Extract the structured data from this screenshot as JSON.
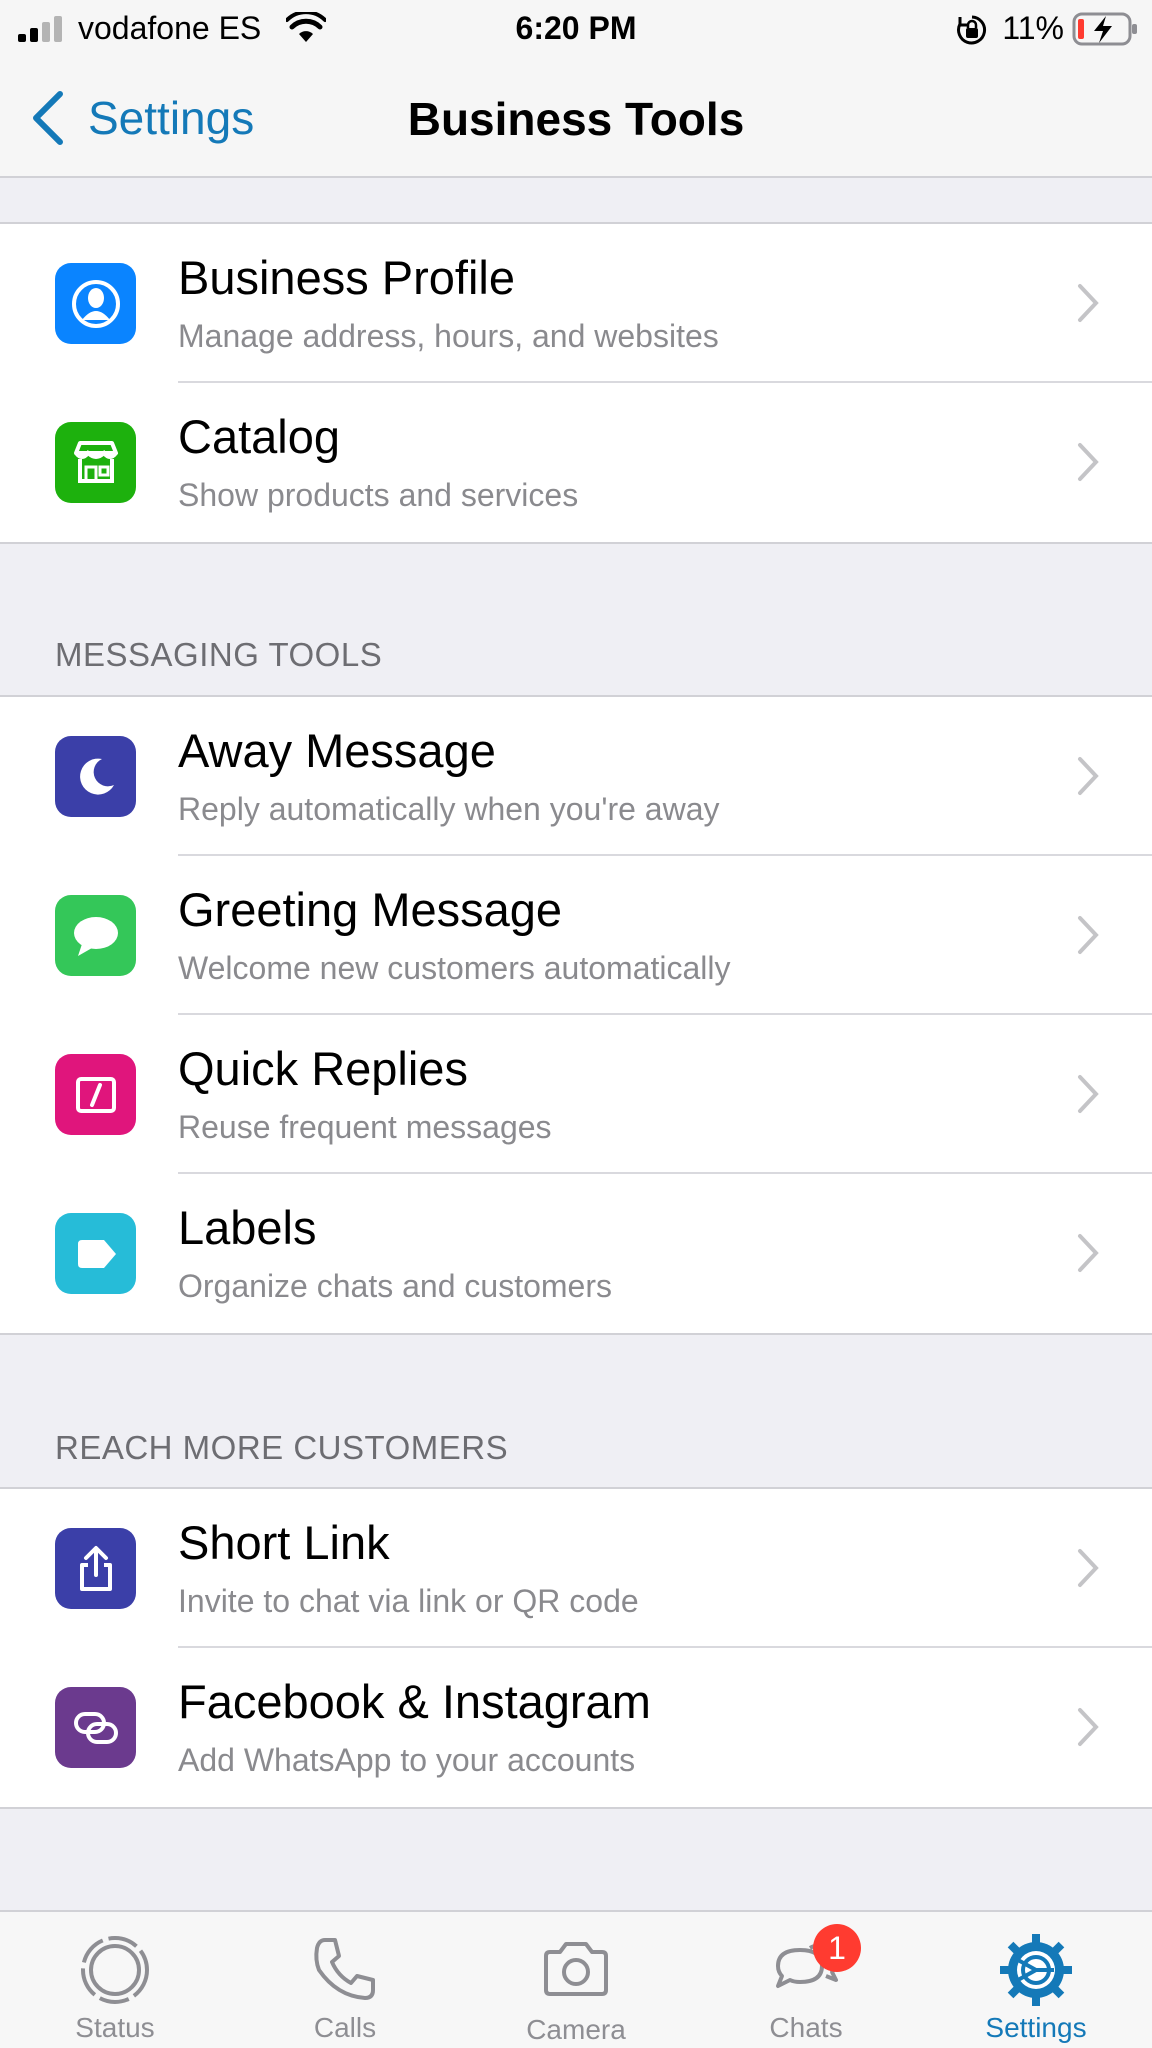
{
  "status_bar": {
    "carrier": "vodafone ES",
    "time": "6:20 PM",
    "battery_percent": "11%"
  },
  "nav": {
    "back_label": "Settings",
    "title": "Business Tools"
  },
  "groups": {
    "profile": [
      {
        "title": "Business Profile",
        "subtitle": "Manage address, hours, and websites",
        "icon": "business-profile-icon",
        "color": "#0a84ff"
      },
      {
        "title": "Catalog",
        "subtitle": "Show products and services",
        "icon": "storefront-icon",
        "color": "#1db10d"
      }
    ],
    "messaging": {
      "header": "MESSAGING TOOLS",
      "items": [
        {
          "title": "Away Message",
          "subtitle": "Reply automatically when you're away",
          "icon": "moon-icon",
          "color": "#3b3fa8"
        },
        {
          "title": "Greeting Message",
          "subtitle": "Welcome new customers automatically",
          "icon": "chat-bubble-icon",
          "color": "#34c759"
        },
        {
          "title": "Quick Replies",
          "subtitle": "Reuse frequent messages",
          "icon": "slash-box-icon",
          "color": "#e0157c"
        },
        {
          "title": "Labels",
          "subtitle": "Organize chats and customers",
          "icon": "label-tag-icon",
          "color": "#26bcd8"
        }
      ]
    },
    "reach": {
      "header": "REACH MORE CUSTOMERS",
      "items": [
        {
          "title": "Short Link",
          "subtitle": "Invite to chat via link or QR code",
          "icon": "share-icon",
          "color": "#3b3fa8"
        },
        {
          "title": "Facebook & Instagram",
          "subtitle": "Add WhatsApp to your accounts",
          "icon": "link-rings-icon",
          "color": "#6b3a8e"
        }
      ]
    }
  },
  "tab_bar": {
    "status": "Status",
    "calls": "Calls",
    "camera": "Camera",
    "chats": "Chats",
    "chats_badge": "1",
    "settings": "Settings",
    "active": "settings",
    "active_color": "#1479b8"
  }
}
